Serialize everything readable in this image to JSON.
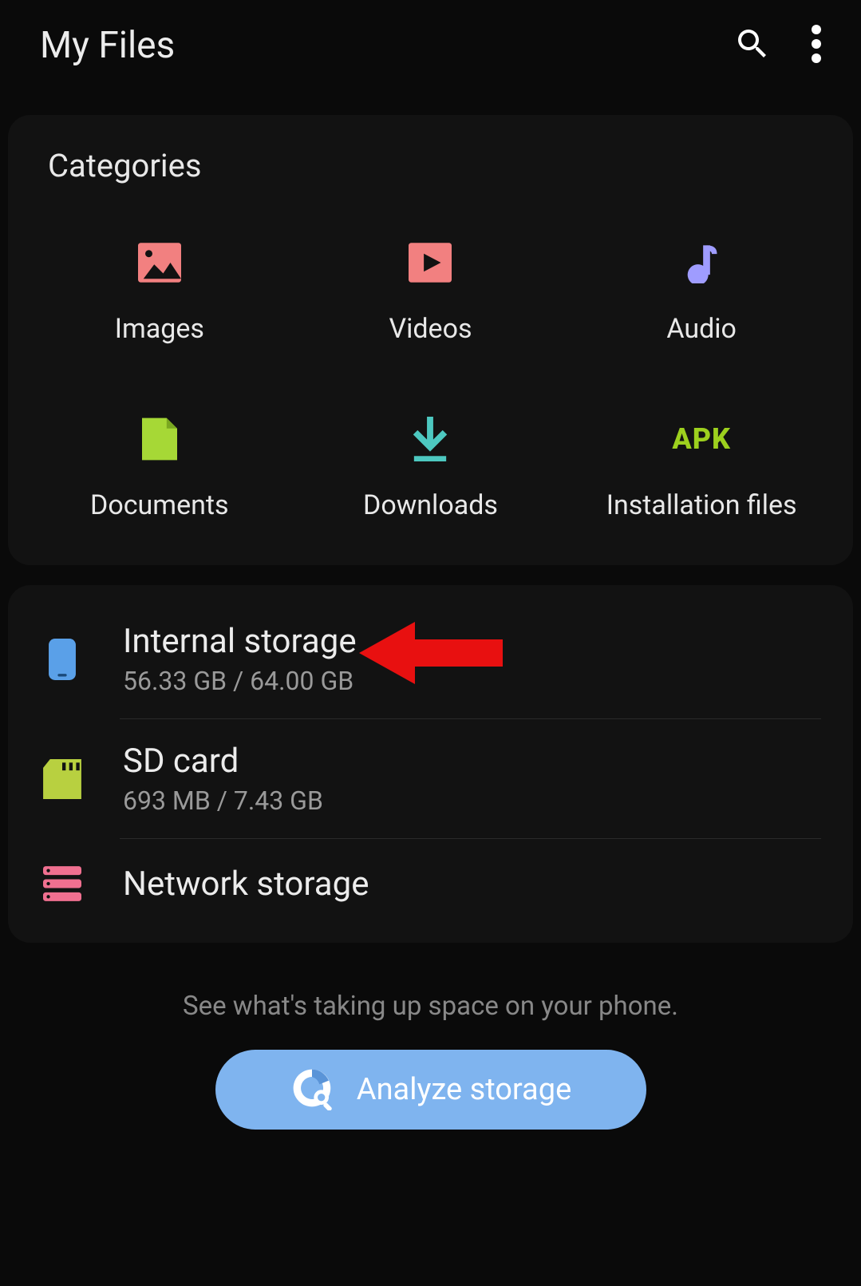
{
  "header": {
    "title": "My Files"
  },
  "categories": {
    "title": "Categories",
    "items": [
      {
        "label": "Images"
      },
      {
        "label": "Videos"
      },
      {
        "label": "Audio"
      },
      {
        "label": "Documents"
      },
      {
        "label": "Downloads"
      },
      {
        "label": "Installation files",
        "apk_text": "APK"
      }
    ]
  },
  "storage": {
    "internal": {
      "title": "Internal storage",
      "sub": "56.33 GB / 64.00 GB"
    },
    "sd": {
      "title": "SD card",
      "sub": "693 MB / 7.43 GB"
    },
    "network": {
      "title": "Network storage"
    }
  },
  "footer": {
    "hint": "See what's taking up space on your phone.",
    "button": "Analyze storage"
  }
}
